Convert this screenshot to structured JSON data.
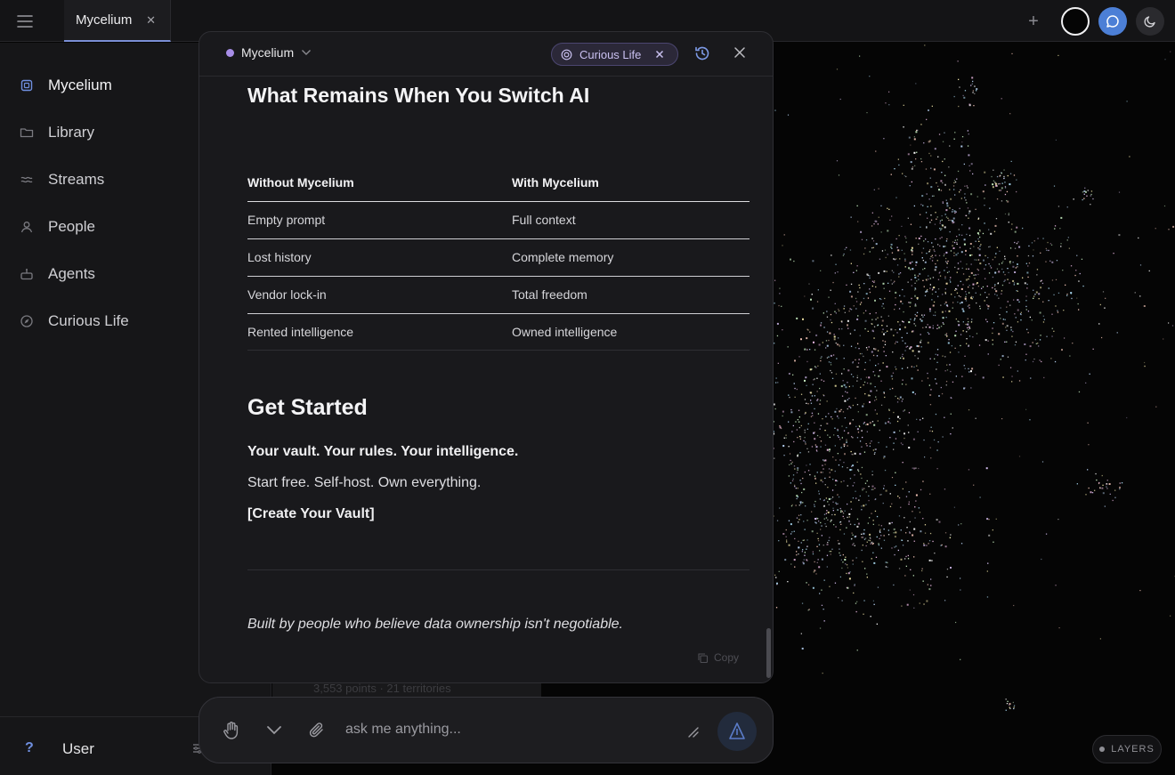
{
  "topbar": {
    "menu_icon": "hamburger-menu-icon",
    "tab": {
      "label": "Mycelium",
      "close": "✕"
    },
    "plus": "+"
  },
  "sidebar": {
    "items": [
      {
        "label": "Mycelium",
        "icon": "cube-icon"
      },
      {
        "label": "Library",
        "icon": "folder-icon"
      },
      {
        "label": "Streams",
        "icon": "waves-icon"
      },
      {
        "label": "People",
        "icon": "person-icon"
      },
      {
        "label": "Agents",
        "icon": "robot-icon"
      },
      {
        "label": "Curious Life",
        "icon": "compass-icon"
      }
    ],
    "footer": {
      "help": "?",
      "user": "User"
    }
  },
  "background": {
    "faint_text": "3,553 points · 21 territories"
  },
  "panel": {
    "workspace": "Mycelium",
    "chip_label": "Curious Life",
    "heading": "What Remains When You Switch AI",
    "table": {
      "headers": [
        "Without Mycelium",
        "With Mycelium"
      ],
      "rows": [
        [
          "Empty prompt",
          "Full context"
        ],
        [
          "Lost history",
          "Complete memory"
        ],
        [
          "Vendor lock-in",
          "Total freedom"
        ],
        [
          "Rented intelligence",
          "Owned intelligence"
        ]
      ]
    },
    "get_started": {
      "heading": "Get Started",
      "tagline": "Your vault. Your rules. Your intelligence.",
      "sub": "Start free. Self-host. Own everything.",
      "cta": "[Create Your Vault]"
    },
    "footer_note": "Built by people who believe data ownership isn't negotiable.",
    "copy_label": "Copy"
  },
  "input": {
    "placeholder": "ask me anything..."
  },
  "map": {
    "layers_label": "LAYERS"
  },
  "colors": {
    "accent": "#4c7fd6",
    "workspace_dot": "#a88ee8",
    "chip_bg": "#2b2838"
  }
}
